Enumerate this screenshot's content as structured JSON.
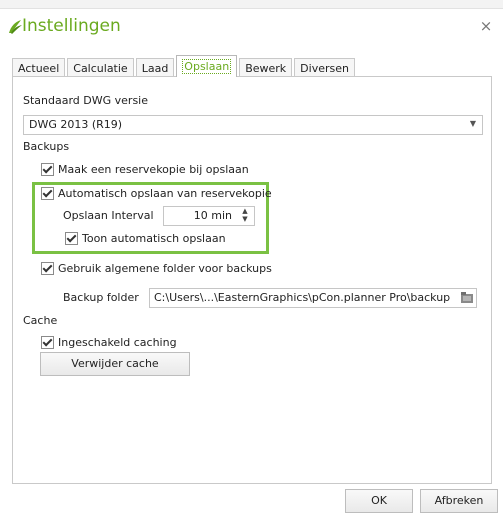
{
  "window": {
    "title": "Instellingen",
    "close_symbol": "×"
  },
  "tabs": [
    {
      "label": "Actueel"
    },
    {
      "label": "Calculatie"
    },
    {
      "label": "Laad"
    },
    {
      "label": "Opslaan"
    },
    {
      "label": "Bewerk"
    },
    {
      "label": "Diversen"
    }
  ],
  "active_tab": "Opslaan",
  "panel": {
    "dwg_version_label": "Standaard DWG versie",
    "dwg_version_value": "DWG 2013 (R19)",
    "backups_heading": "Backups",
    "backup_on_save": {
      "label": "Maak een reservekopie bij opslaan",
      "checked": true
    },
    "auto_save": {
      "label": "Automatisch opslaan van reservekopie",
      "checked": true
    },
    "interval_label": "Opslaan Interval",
    "interval_value": "10 min",
    "show_auto_save": {
      "label": "Toon automatisch opslaan",
      "checked": true
    },
    "general_folder": {
      "label": "Gebruik algemene folder voor backups",
      "checked": true
    },
    "backup_folder_label": "Backup folder",
    "backup_folder_path": "C:\\Users\\...\\EasternGraphics\\pCon.planner Pro\\backup",
    "cache_heading": "Cache",
    "caching_enabled": {
      "label": "Ingeschakeld caching",
      "checked": true
    },
    "clear_cache_button": "Verwijder cache"
  },
  "footer": {
    "ok_button": "OK",
    "cancel_button": "Afbreken"
  },
  "colors": {
    "accent": "#6aaa1f",
    "highlight": "#7ac143"
  }
}
